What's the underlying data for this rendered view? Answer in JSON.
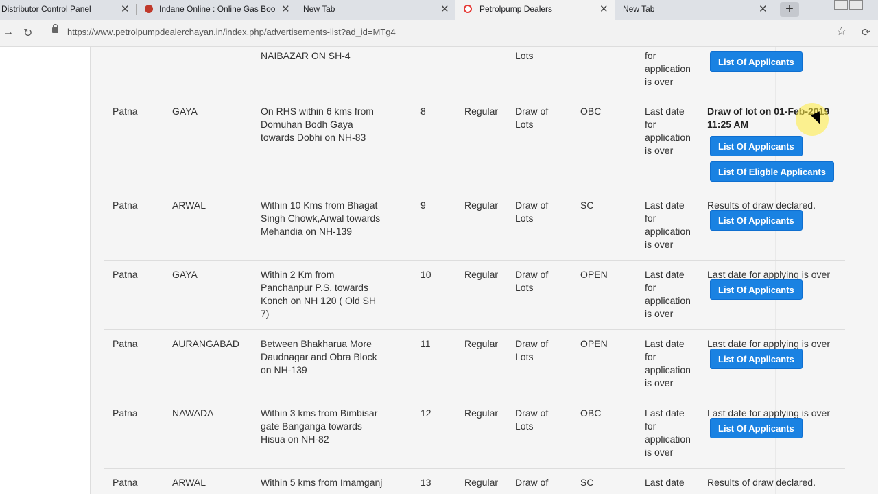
{
  "browser": {
    "tabs": [
      {
        "title": "Distributor Control Panel",
        "active": false
      },
      {
        "title": "Indane Online : Online Gas Book",
        "active": false
      },
      {
        "title": "New Tab",
        "active": false
      },
      {
        "title": "Petrolpump Dealers",
        "active": true
      },
      {
        "title": "New Tab",
        "active": false
      }
    ],
    "close_glyph": "✕",
    "new_tab_glyph": "+",
    "url": "https://www.petrolpumpdealerchayan.in/index.php/advertisements-list?ad_id=MTg4",
    "icons": [
      "back-icon",
      "reload-icon",
      "lock-icon",
      "star-icon",
      "extension-icon"
    ]
  },
  "partial_row": {
    "location": "NAIBAZAR ON SH-4",
    "category_tail": "Lots",
    "status": [
      "for",
      "application",
      "is over"
    ],
    "buttons": [
      "List Of Applicants"
    ]
  },
  "rows": [
    {
      "state": "Patna",
      "district": "GAYA",
      "location": "On RHS within 6 kms from Domuhan Bodh Gaya towards Dobhi on NH-83",
      "sno": "8",
      "type": "Regular",
      "method": "Draw of Lots",
      "category": "OBC",
      "last_date": "Last date for application is over",
      "result": "Draw of lot on 01-Feb-2019 11:25 AM",
      "result_bold": true,
      "buttons": [
        "List Of Applicants",
        "List Of Eligble Applicants"
      ]
    },
    {
      "state": "Patna",
      "district": "ARWAL",
      "location": "Within 10 Kms from Bhagat Singh Chowk,Arwal towards Mehandia on NH-139",
      "sno": "9",
      "type": "Regular",
      "method": "Draw of Lots",
      "category": "SC",
      "last_date": "Last date for application is over",
      "result": "Results of draw declared.",
      "buttons": [
        "List Of Applicants"
      ]
    },
    {
      "state": "Patna",
      "district": "GAYA",
      "location": "Within 2 Km from Panchanpur P.S. towards Konch on NH 120 ( Old SH 7)",
      "sno": "10",
      "type": "Regular",
      "method": "Draw of Lots",
      "category": "OPEN",
      "last_date": "Last date for application is over",
      "result": "Last date for applying is over",
      "buttons": [
        "List Of Applicants"
      ]
    },
    {
      "state": "Patna",
      "district": "AURANGABAD",
      "location": "Between Bhakharua More Daudnagar and Obra Block on NH-139",
      "sno": "11",
      "type": "Regular",
      "method": "Draw of Lots",
      "category": "OPEN",
      "last_date": "Last date for application is over",
      "result": "Last date for applying is over",
      "buttons": [
        "List Of Applicants"
      ]
    },
    {
      "state": "Patna",
      "district": "NAWADA",
      "location": "Within 3 kms from Bimbisar gate Banganga towards Hisua on NH-82",
      "sno": "12",
      "type": "Regular",
      "method": "Draw of Lots",
      "category": "OBC",
      "last_date": "Last date for application is over",
      "result": "Last date for applying is over",
      "buttons": [
        "List Of Applicants"
      ]
    },
    {
      "state": "Patna",
      "district": "ARWAL",
      "location": "Within 5 kms from Imamganj",
      "sno": "13",
      "type": "Regular",
      "method": "Draw of",
      "category": "SC",
      "last_date": "Last date",
      "result": "Results of draw declared.",
      "buttons": []
    }
  ],
  "colors": {
    "button": "#1a82e2",
    "panel": "#f5f5f5",
    "cursor_highlight": "#ffeb3b"
  }
}
